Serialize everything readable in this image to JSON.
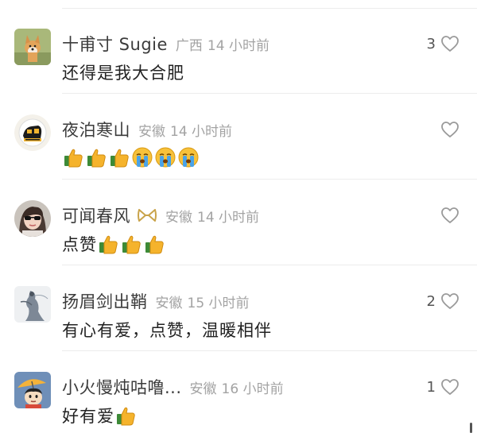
{
  "colors": {
    "username": "#3b3b3b",
    "meta_text": "#a3a3a3",
    "content_text": "#222222",
    "heart_outline": "#9a9a9a",
    "badge_gold": "#c9a34a"
  },
  "comments": [
    {
      "username": "十甫寸 Sugie",
      "location": "广西",
      "time": "14 小时前",
      "text": "还得是我大合肥",
      "emojis": [],
      "likes": "3",
      "avatar_icon": "corgi-dog-avatar"
    },
    {
      "username": "夜泊寒山",
      "location": "安徽",
      "time": "14 小时前",
      "text": "",
      "emojis": [
        "thumbs-up-emoji",
        "thumbs-up-emoji",
        "thumbs-up-emoji",
        "crying-face-emoji",
        "crying-face-emoji",
        "crying-face-emoji"
      ],
      "likes": "",
      "avatar_icon": "cartoon-logo-avatar"
    },
    {
      "username": "可闻春风",
      "location": "安徽",
      "time": "14 小时前",
      "text": "点赞",
      "emojis": [
        "thumbs-up-emoji",
        "thumbs-up-emoji",
        "thumbs-up-emoji"
      ],
      "likes": "",
      "avatar_icon": "woman-sunglasses-avatar",
      "badge_icon": "gold-ribbon-badge-icon"
    },
    {
      "username": "扬眉剑出鞘",
      "location": "安徽",
      "time": "15 小时前",
      "text": "有心有爱，点赞，温暖相伴",
      "emojis": [],
      "likes": "2",
      "avatar_icon": "ink-painting-avatar"
    },
    {
      "username": "小火慢炖咕噜...",
      "location": "安徽",
      "time": "16 小时前",
      "text": "好有爱",
      "emojis": [
        "thumbs-up-emoji"
      ],
      "likes": "1",
      "avatar_icon": "cartoon-kid-umbrella-avatar"
    }
  ]
}
